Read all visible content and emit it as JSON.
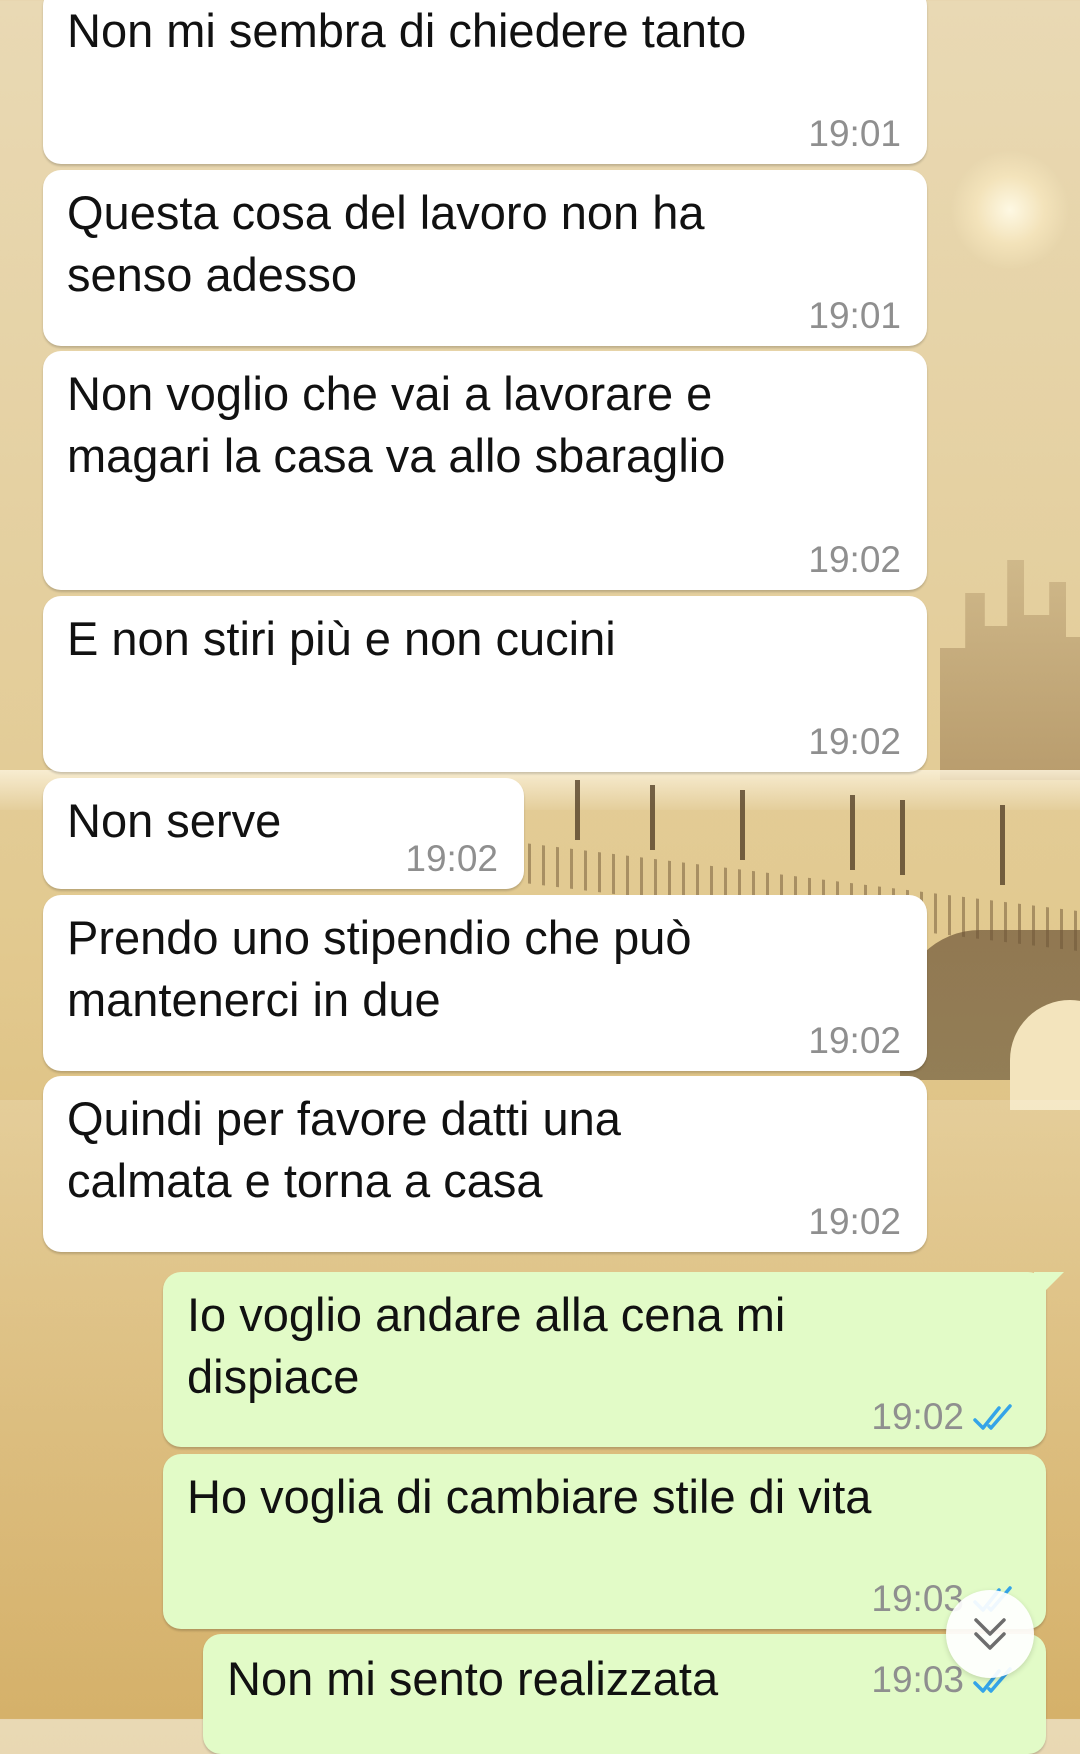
{
  "messages": [
    {
      "direction": "incoming",
      "text": "Non mi sembra di chiedere tanto",
      "time": "19:01"
    },
    {
      "direction": "incoming",
      "text": "Questa cosa del lavoro non ha\nsenso adesso",
      "time": "19:01"
    },
    {
      "direction": "incoming",
      "text": "Non voglio che vai a lavorare e\nmagari la casa va allo sbaraglio",
      "time": "19:02"
    },
    {
      "direction": "incoming",
      "text": "E non stiri più e non cucini",
      "time": "19:02"
    },
    {
      "direction": "incoming",
      "text": "Non serve",
      "time": "19:02"
    },
    {
      "direction": "incoming",
      "text": "Prendo uno stipendio che può\nmantenerci in due",
      "time": "19:02"
    },
    {
      "direction": "incoming",
      "text": "Quindi per favore datti una\ncalmata e torna a casa",
      "time": "19:02"
    },
    {
      "direction": "outgoing",
      "text": "Io voglio andare alla cena mi\ndispiace",
      "time": "19:02",
      "status": "read"
    },
    {
      "direction": "outgoing",
      "text": "Ho voglia di cambiare stile di vita",
      "time": "19:03",
      "status": "read"
    },
    {
      "direction": "outgoing",
      "text": "Non mi sento realizzata",
      "time": "19:03",
      "status": "read"
    }
  ],
  "icons": {
    "read_receipt": "double-check-icon",
    "scroll_down": "chevron-double-down-icon"
  },
  "colors": {
    "incoming_bubble": "#ffffff",
    "outgoing_bubble": "#e2fbc7",
    "timestamp": "#8f8f8f",
    "read_tick": "#34a4e8"
  }
}
